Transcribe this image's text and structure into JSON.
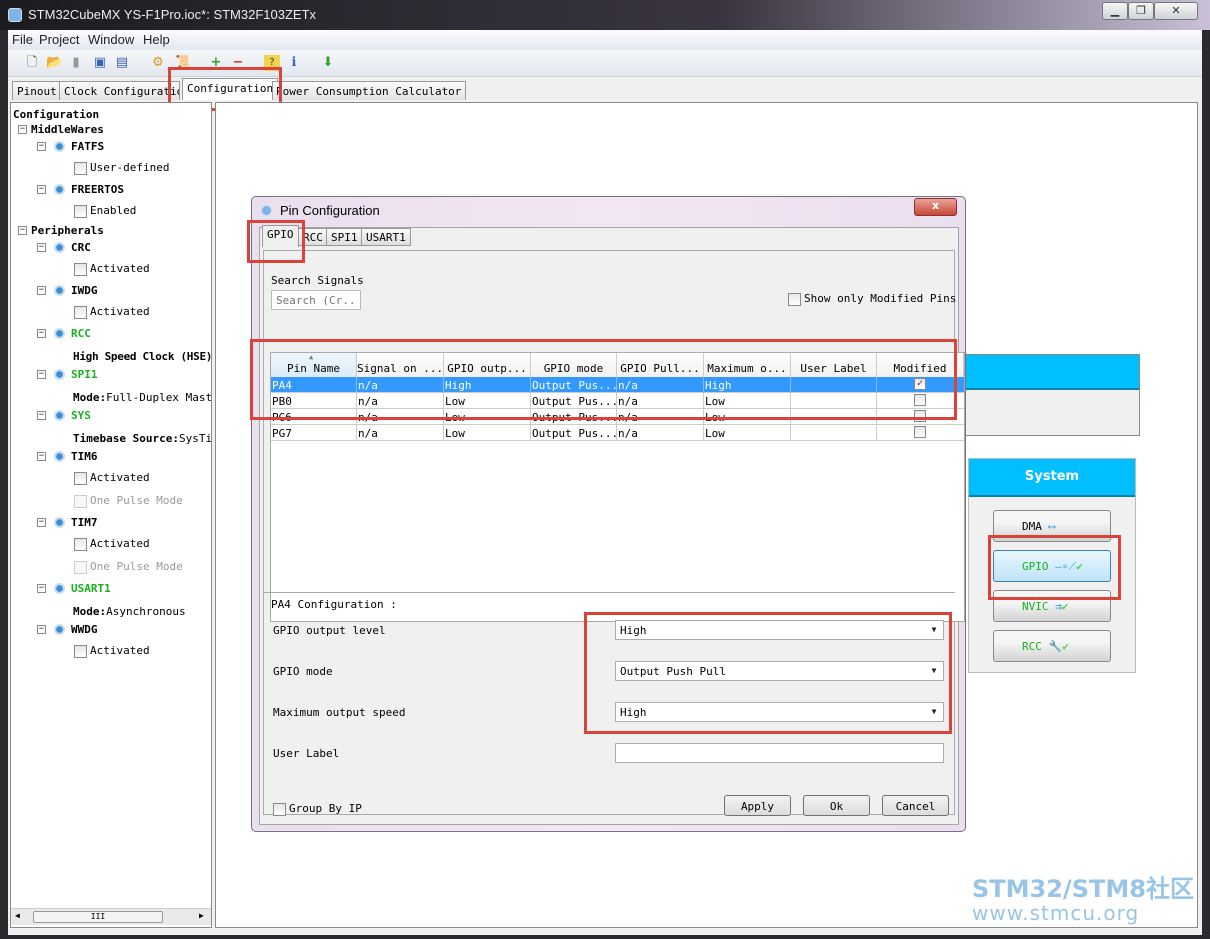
{
  "window": {
    "title": "STM32CubeMX YS-F1Pro.ioc*: STM32F103ZETx",
    "controls": [
      "minimize",
      "maximize",
      "close"
    ]
  },
  "menu": [
    "File",
    "Project",
    "Window",
    "Help"
  ],
  "toolbar": [
    "new-project-icon",
    "open-icon",
    "copy-icon",
    "save-icon",
    "save-as-icon",
    "generate-code-icon",
    "report-icon",
    "zoom-in-icon",
    "zoom-out-icon",
    "help-icon",
    "about-icon",
    "download-icon"
  ],
  "tabs": [
    {
      "label": "Pinout"
    },
    {
      "label": "Clock Configuration"
    },
    {
      "label": "Configuration",
      "active": true
    },
    {
      "label": "Power Consumption Calculator"
    }
  ],
  "tree": [
    {
      "label": "Configuration",
      "level": 0
    },
    {
      "label": "MiddleWares",
      "level": 1
    },
    {
      "label": "FATFS",
      "level": 2
    },
    {
      "label": "User-defined",
      "level": 3,
      "check": true
    },
    {
      "label": "FREERTOS",
      "level": 2
    },
    {
      "label": "Enabled",
      "level": 3,
      "check": true
    },
    {
      "label": "Peripherals",
      "level": 1
    },
    {
      "label": "CRC",
      "level": 2
    },
    {
      "label": "Activated",
      "level": 3,
      "check": true
    },
    {
      "label": "IWDG",
      "level": 2
    },
    {
      "label": "Activated",
      "level": 3,
      "check": true
    },
    {
      "label": "RCC",
      "level": 2,
      "green": true
    },
    {
      "label": "High Speed Clock (HSE)",
      "level": 3,
      "key": "High Speed Clock (HS"
    },
    {
      "label": "SPI1",
      "level": 2,
      "green": true
    },
    {
      "label": "Full-Duplex Master",
      "level": 3,
      "key": "Mode"
    },
    {
      "label": "SYS",
      "level": 2,
      "green": true
    },
    {
      "label": "SysTick",
      "level": 3,
      "key": "Timebase Source"
    },
    {
      "label": "TIM6",
      "level": 2
    },
    {
      "label": "Activated",
      "level": 3,
      "check": true
    },
    {
      "label": "One Pulse Mode",
      "level": 3,
      "check": true,
      "disabled": true
    },
    {
      "label": "TIM7",
      "level": 2
    },
    {
      "label": "Activated",
      "level": 3,
      "check": true
    },
    {
      "label": "One Pulse Mode",
      "level": 3,
      "check": true,
      "disabled": true
    },
    {
      "label": "USART1",
      "level": 2,
      "green": true
    },
    {
      "label": "Asynchronous",
      "level": 3,
      "key": "Mode"
    },
    {
      "label": "WWDG",
      "level": 2
    },
    {
      "label": "Activated",
      "level": 3,
      "check": true
    }
  ],
  "system_panel": {
    "title": "System",
    "buttons": [
      "DMA",
      "GPIO",
      "NVIC",
      "RCC"
    ],
    "selected": "GPIO"
  },
  "dialog": {
    "title": "Pin Configuration",
    "tabs": [
      "GPIO",
      "RCC",
      "SPI1",
      "USART1"
    ],
    "active_tab": "GPIO",
    "search_label": "Search Signals",
    "search_placeholder": "Search (Cr...",
    "show_modified_label": "Show only Modified Pins",
    "columns": [
      "Pin Name",
      "Signal on ...",
      "GPIO outp...",
      "GPIO mode",
      "GPIO Pull...",
      "Maximum o...",
      "User Label",
      "Modified"
    ],
    "rows": [
      {
        "cells": [
          "PA4",
          "n/a",
          "High",
          "Output Pus...",
          "n/a",
          "High",
          ""
        ],
        "modified": true,
        "selected": true
      },
      {
        "cells": [
          "PB0",
          "n/a",
          "Low",
          "Output Pus...",
          "n/a",
          "Low",
          ""
        ],
        "modified": false
      },
      {
        "cells": [
          "PG6",
          "n/a",
          "Low",
          "Output Pus...",
          "n/a",
          "Low",
          ""
        ],
        "modified": false
      },
      {
        "cells": [
          "PG7",
          "n/a",
          "Low",
          "Output Pus...",
          "n/a",
          "Low",
          ""
        ],
        "modified": false
      }
    ],
    "config_title": "PA4 Configuration :",
    "fields": [
      {
        "label": "GPIO output level",
        "value": "High"
      },
      {
        "label": "GPIO mode",
        "value": "Output Push Pull"
      },
      {
        "label": "Maximum output speed",
        "value": "High"
      },
      {
        "label": "User Label",
        "value": ""
      }
    ],
    "group_by_ip": "Group By IP",
    "apply": "Apply",
    "ok": "Ok",
    "cancel": "Cancel"
  },
  "watermark": {
    "line1": "STM32/STM8社区",
    "line2": "www.stmcu.org"
  },
  "colors": {
    "highlight": "#d9433a",
    "selection": "#3399ff",
    "active_peripheral": "#17b21c",
    "system_header": "#00bfff"
  }
}
